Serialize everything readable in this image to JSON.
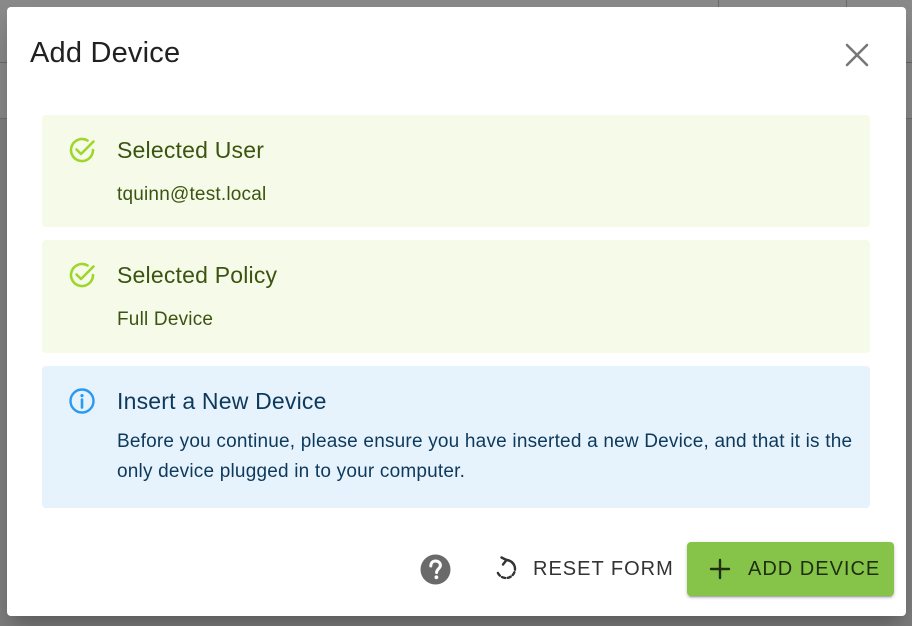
{
  "dialog": {
    "title": "Add Device",
    "close_icon": "close-icon"
  },
  "alerts": [
    {
      "type": "success",
      "icon": "check-circle-icon",
      "title": "Selected User",
      "body": "tquinn@test.local"
    },
    {
      "type": "success",
      "icon": "check-circle-icon",
      "title": "Selected Policy",
      "body": "Full Device"
    },
    {
      "type": "info",
      "icon": "info-circle-icon",
      "title": "Insert a New Device",
      "body": "Before you continue, please ensure you have inserted a new Device, and that it is the only device plugged in to your computer."
    }
  ],
  "actions": {
    "help_icon": "help-circle-icon",
    "reset_label": "RESET FORM",
    "reset_icon": "restart-icon",
    "add_label": "ADD DEVICE",
    "add_icon": "plus-icon"
  },
  "colors": {
    "success_bg": "#f6fbe9",
    "success_icon": "#9ed62b",
    "success_text": "#3b5410",
    "info_bg": "#e6f2fc",
    "info_icon": "#2a9af0",
    "info_text": "#0d3a5c",
    "primary_button": "#86c449"
  }
}
